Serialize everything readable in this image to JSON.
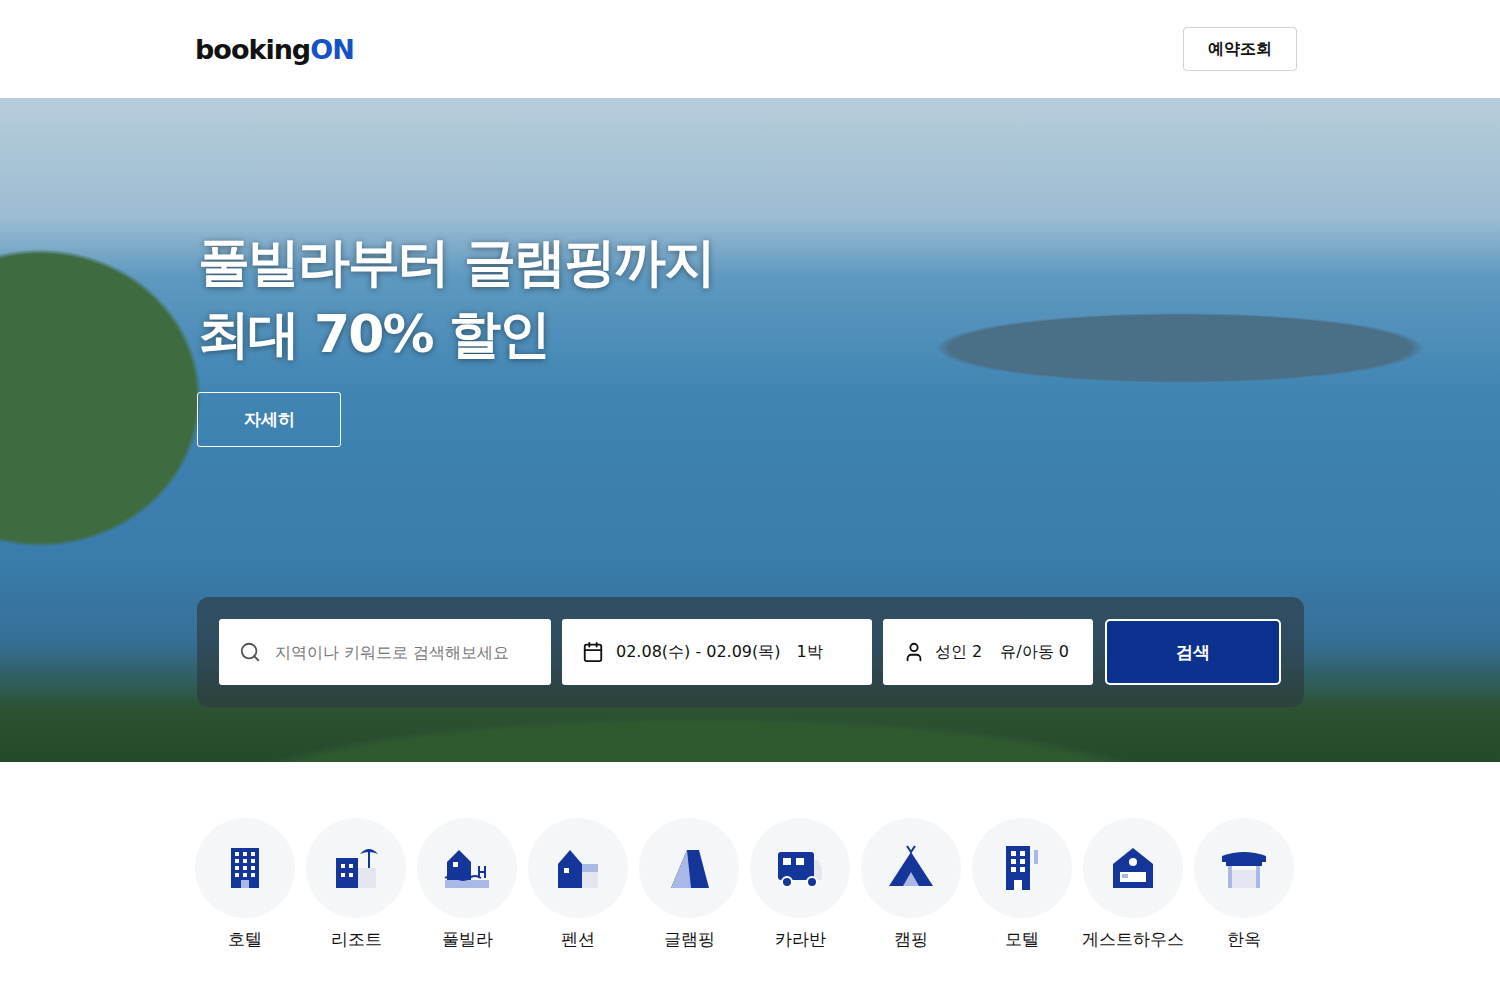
{
  "header": {
    "logo": {
      "main": "booking",
      "accent": "ON"
    },
    "button": "예약조회"
  },
  "hero": {
    "title_lines": [
      "풀빌라부터 글램핑까지",
      "최대 70% 할인"
    ],
    "detail_button": "자세히"
  },
  "search": {
    "placeholder": "지역이나 키워드로 검색해보세요",
    "dates": "02.08(수) - 02.09(목)",
    "nights": "1박",
    "adults": "성인 2",
    "children": "유/아동 0",
    "button": "검색"
  },
  "categories": [
    {
      "label": "호텔"
    },
    {
      "label": "리조트"
    },
    {
      "label": "풀빌라"
    },
    {
      "label": "펜션"
    },
    {
      "label": "글램핑"
    },
    {
      "label": "카라반"
    },
    {
      "label": "캠핑"
    },
    {
      "label": "모텔"
    },
    {
      "label": "게스트하우스"
    },
    {
      "label": "한옥"
    }
  ]
}
